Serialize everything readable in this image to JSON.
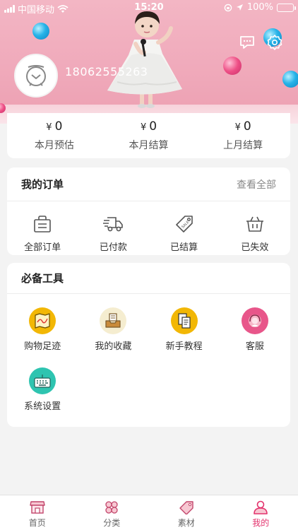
{
  "status_bar": {
    "carrier": "中国移动",
    "time": "15:20",
    "battery": "100%"
  },
  "profile": {
    "phone": "18062555263"
  },
  "stats": [
    {
      "currency": "¥",
      "value": "0",
      "label": "本月预估"
    },
    {
      "currency": "¥",
      "value": "0",
      "label": "本月结算"
    },
    {
      "currency": "¥",
      "value": "0",
      "label": "上月结算"
    }
  ],
  "orders": {
    "title": "我的订单",
    "view_all": "查看全部",
    "items": [
      {
        "label": "全部订单",
        "icon": "bag-icon"
      },
      {
        "label": "已付款",
        "icon": "truck-icon"
      },
      {
        "label": "已结算",
        "icon": "sale-tag-icon"
      },
      {
        "label": "已失效",
        "icon": "basket-icon"
      }
    ]
  },
  "tools": {
    "title": "必备工具",
    "items": [
      {
        "label": "购物足迹",
        "icon": "map-icon",
        "color": "#f2b705"
      },
      {
        "label": "我的收藏",
        "icon": "inbox-icon",
        "color": "#f5edd0"
      },
      {
        "label": "新手教程",
        "icon": "document-icon",
        "color": "#f2b705"
      },
      {
        "label": "客服",
        "icon": "service-icon",
        "color": "#e8568a"
      },
      {
        "label": "系统设置",
        "icon": "keyboard-icon",
        "color": "#2ec4b0"
      }
    ]
  },
  "tabbar": {
    "items": [
      {
        "label": "首页",
        "icon": "shop-icon",
        "active": false
      },
      {
        "label": "分类",
        "icon": "category-icon",
        "active": false
      },
      {
        "label": "素材",
        "icon": "tag-icon",
        "active": false
      },
      {
        "label": "我的",
        "icon": "person-icon",
        "active": true
      }
    ]
  },
  "colors": {
    "accent": "#e3316c",
    "hero_pink": "#f0aabb"
  }
}
